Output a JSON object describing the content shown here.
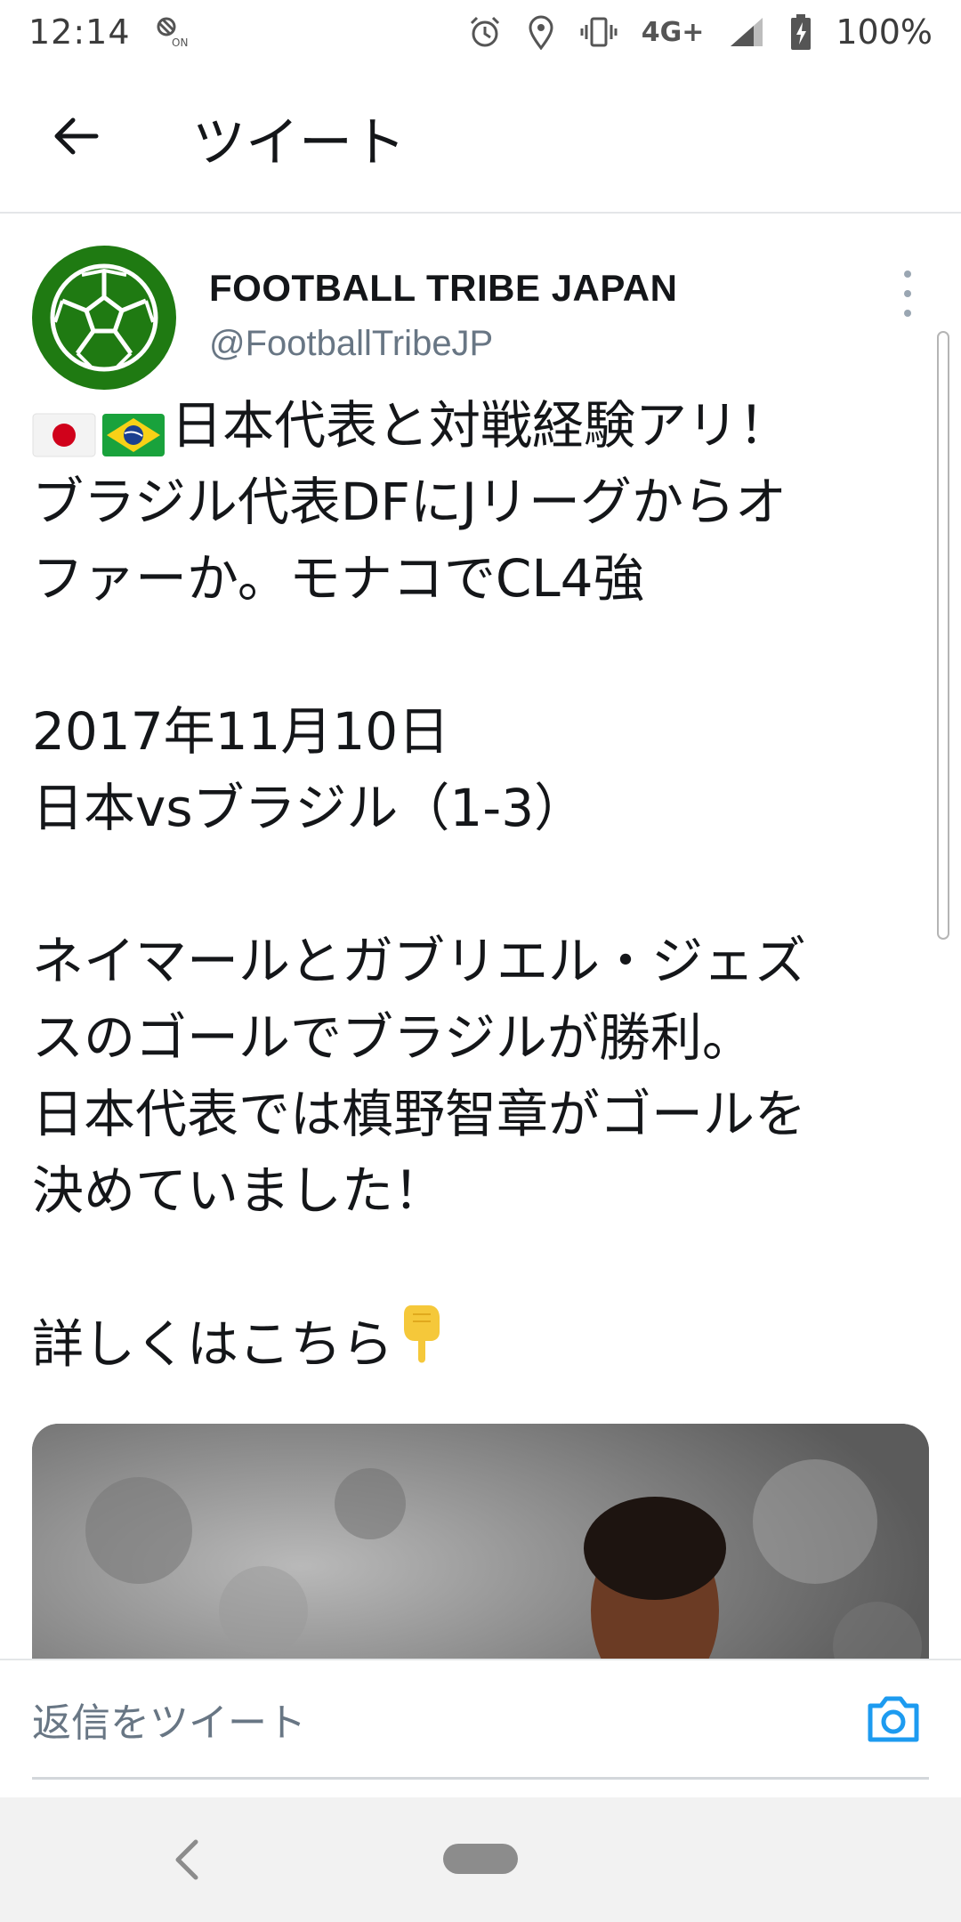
{
  "status_bar": {
    "time": "12:14",
    "network": "4G+",
    "battery": "100%",
    "icons": [
      "nfc-on-icon",
      "alarm-icon",
      "location-icon",
      "vibrate-icon",
      "signal-icon",
      "battery-charging-icon"
    ]
  },
  "header": {
    "title": "ツイート",
    "back_icon": "arrow-left-icon"
  },
  "tweet": {
    "author": {
      "name": "FOOTBALL TRIBE JAPAN",
      "handle": "@FootballTribeJP",
      "avatar_icon": "soccer-ball-logo"
    },
    "body": {
      "line1": "日本代表と対戦経験アリ！",
      "line2": "ブラジル代表DFにJリーグからオ",
      "line3": "ファーか。モナコでCL4強",
      "line4": "2017年11月10日",
      "line5": "日本vsブラジル（1-3）",
      "line6": "ネイマールとガブリエル・ジェズ",
      "line7": "スのゴールでブラジルが勝利。",
      "line8": "日本代表では槙野智章がゴールを",
      "line9": "決めていました！",
      "line10": "詳しくはこちら"
    },
    "emojis": [
      "flag-japan",
      "flag-brazil",
      "backhand-index-pointing-down"
    ],
    "media": "player-photo"
  },
  "reply": {
    "placeholder": "返信をツイート",
    "camera_icon": "camera-icon"
  },
  "colors": {
    "accent": "#1d9bf0",
    "avatar_green": "#1f7a12",
    "handle_gray": "#687684"
  }
}
